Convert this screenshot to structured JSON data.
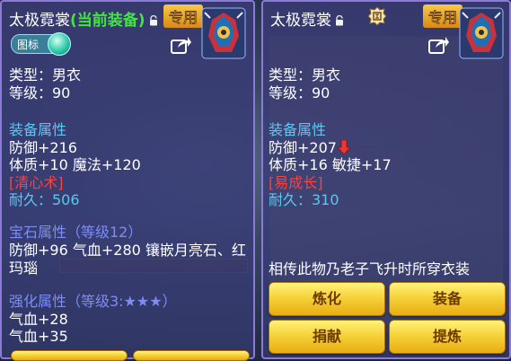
{
  "left_panel": {
    "title": "太极霓裳",
    "title_status": "(当前装备)",
    "badge": "专用",
    "toggle_label": "图标",
    "type_line": "类型：男衣",
    "level_line": "等级：90",
    "attr_header": "装备属性",
    "attr_lines": [
      "防御+216",
      "体质+10 魔法+120"
    ],
    "special": "[清心术]",
    "durability": "耐久：506",
    "gem_header": "宝石属性（等级12）",
    "gem_lines": [
      "防御+96 气血+280 镶嵌月亮石、红",
      "玛瑙"
    ],
    "enhance_header": "强化属性（等级3:★★★）",
    "enhance_lines": [
      "气血+28",
      "气血+35"
    ]
  },
  "right_panel": {
    "title": "太极霓裳",
    "badge": "专用",
    "type_line": "类型：男衣",
    "level_line": "等级：90",
    "attr_header": "装备属性",
    "attr_lines": [
      "防御+207",
      "体质+16 敏捷+17"
    ],
    "special": "[易成长]",
    "durability": "耐久：310",
    "description": "相传此物乃老子飞升时所穿衣装",
    "buttons": [
      "炼化",
      "装备",
      "捐献",
      "提炼"
    ]
  },
  "colors": {
    "cyan": "#5ac8f0",
    "green": "#3fe640",
    "red": "#ff4040",
    "lavender": "#7e8cf5",
    "gold": "#f6d23a"
  },
  "icons": [
    "lock-icon",
    "seal-icon",
    "share-icon",
    "down-arrow-icon",
    "item-icon"
  ]
}
